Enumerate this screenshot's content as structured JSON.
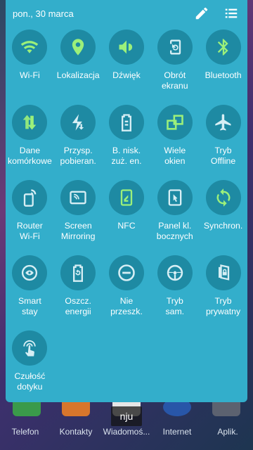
{
  "header": {
    "date": "pon., 30 marca",
    "edit_icon": "pencil-icon",
    "list_icon": "list-icon"
  },
  "colors": {
    "panel": "#33aecb",
    "tile_circle": "#1e8aa3",
    "active_icon": "#9cf07a",
    "inactive_icon": "#d6eef4"
  },
  "tiles": [
    {
      "label": "Wi-Fi",
      "icon": "wifi-icon",
      "active": true
    },
    {
      "label": "Lokalizacja",
      "icon": "location-pin-icon",
      "active": true
    },
    {
      "label": "Dźwięk",
      "icon": "speaker-icon",
      "active": true
    },
    {
      "label": "Obrót\nekranu",
      "icon": "screen-rotation-icon",
      "active": false
    },
    {
      "label": "Bluetooth",
      "icon": "bluetooth-icon",
      "active": true
    },
    {
      "label": "Dane\nkomórkowe",
      "icon": "mobile-data-icon",
      "active": true
    },
    {
      "label": "Przysp.\npobieran.",
      "icon": "download-booster-icon",
      "active": false
    },
    {
      "label": "B. nisk.\nzuż. en.",
      "icon": "ultra-power-saving-icon",
      "active": false
    },
    {
      "label": "Wiele\nokien",
      "icon": "multi-window-icon",
      "active": true
    },
    {
      "label": "Tryb\nOffline",
      "icon": "airplane-icon",
      "active": false
    },
    {
      "label": "Router\nWi-Fi",
      "icon": "hotspot-icon",
      "active": false
    },
    {
      "label": "Screen\nMirroring",
      "icon": "screen-mirroring-icon",
      "active": false
    },
    {
      "label": "NFC",
      "icon": "nfc-icon",
      "active": true
    },
    {
      "label": "Panel kl.\nbocznych",
      "icon": "side-key-panel-icon",
      "active": false
    },
    {
      "label": "Synchron.",
      "icon": "sync-icon",
      "active": true
    },
    {
      "label": "Smart\nstay",
      "icon": "smart-stay-icon",
      "active": false
    },
    {
      "label": "Oszcz.\nenergii",
      "icon": "power-saving-icon",
      "active": false
    },
    {
      "label": "Nie\nprzeszk.",
      "icon": "do-not-disturb-icon",
      "active": false
    },
    {
      "label": "Tryb\nsam.",
      "icon": "car-mode-icon",
      "active": false
    },
    {
      "label": "Tryb\nprywatny",
      "icon": "private-mode-icon",
      "active": false
    },
    {
      "label": "Czułość\ndotyku",
      "icon": "touch-sensitivity-icon",
      "active": false
    }
  ],
  "dock": {
    "items": [
      {
        "label": "Telefon",
        "icon": "phone-app-icon"
      },
      {
        "label": "Kontakty",
        "icon": "contacts-app-icon"
      },
      {
        "label": "Wiadomoś...",
        "icon": "messages-app-icon"
      },
      {
        "label": "Internet",
        "icon": "internet-app-icon"
      },
      {
        "label": "Aplik.",
        "icon": "apps-grid-icon"
      }
    ]
  },
  "toast": {
    "text": "nju"
  }
}
